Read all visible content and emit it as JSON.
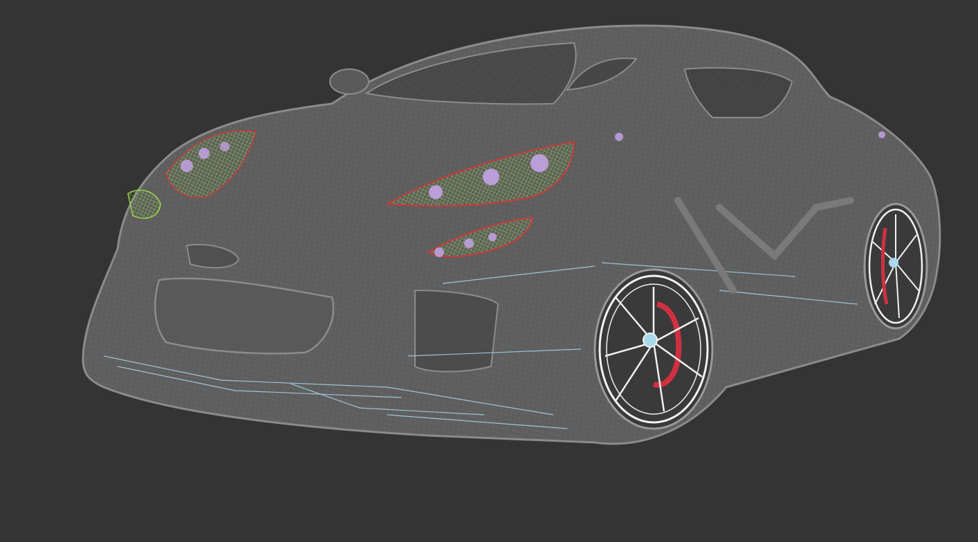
{
  "viewport": {
    "label": "",
    "background_color": "#343434",
    "display_mode": "wireframe",
    "subject": "sports-car-model"
  },
  "colors": {
    "body_wire": "#8c8c8c",
    "body_fill": "#5e5e5e",
    "wheel_wire": "#f2f2f2",
    "brake_caliper": "#d03040",
    "headlight_green": "#9ad84a",
    "headlight_red": "#c83a3a",
    "bulb_lilac": "#c9a6ee",
    "chassis_cyan": "#a8d8ec"
  }
}
